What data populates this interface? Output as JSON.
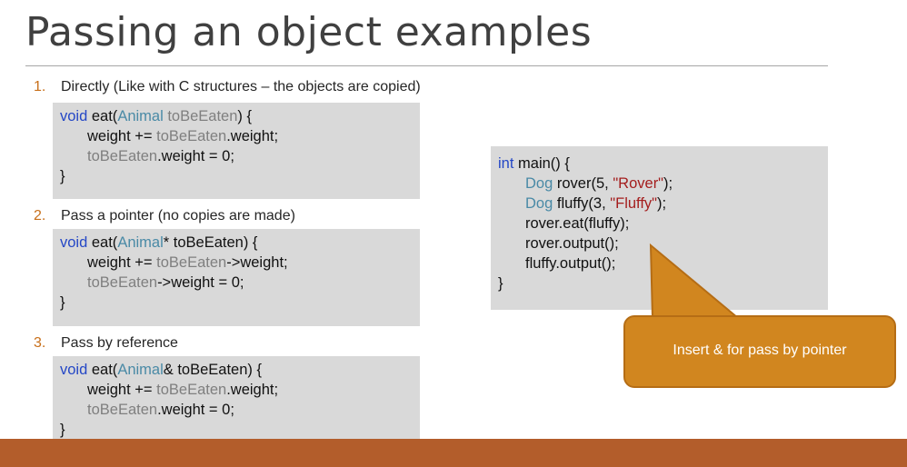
{
  "slide": {
    "title": "Passing an object examples"
  },
  "items": [
    {
      "num": "1.",
      "label": "Directly (Like with C structures – the objects are copied)",
      "code": [
        [
          {
            "t": "void",
            "c": "kw"
          },
          {
            "t": " eat(",
            "c": ""
          },
          {
            "t": "Animal",
            "c": "ty"
          },
          {
            "t": " ",
            "c": ""
          },
          {
            "t": "toBeEaten",
            "c": "id"
          },
          {
            "t": ") {",
            "c": ""
          }
        ],
        [
          {
            "t": "weight += ",
            "c": "",
            "i": 1
          },
          {
            "t": "toBeEaten",
            "c": "id"
          },
          {
            "t": ".weight;",
            "c": ""
          }
        ],
        [
          {
            "t": "toBeEaten",
            "c": "id",
            "i": 1
          },
          {
            "t": ".weight = 0;",
            "c": ""
          }
        ],
        [
          {
            "t": "}",
            "c": ""
          }
        ]
      ]
    },
    {
      "num": "2.",
      "label": "Pass a pointer (no copies are made)",
      "code": [
        [
          {
            "t": "void",
            "c": "kw"
          },
          {
            "t": " eat(",
            "c": ""
          },
          {
            "t": "Animal",
            "c": "ty"
          },
          {
            "t": "* toBeEaten) {",
            "c": ""
          }
        ],
        [
          {
            "t": "weight += ",
            "c": "",
            "i": 1
          },
          {
            "t": "toBeEaten",
            "c": "id"
          },
          {
            "t": "->weight;",
            "c": ""
          }
        ],
        [
          {
            "t": "toBeEaten",
            "c": "id",
            "i": 1
          },
          {
            "t": "->weight = 0;",
            "c": ""
          }
        ],
        [
          {
            "t": "}",
            "c": ""
          }
        ]
      ]
    },
    {
      "num": "3.",
      "label": "Pass by reference",
      "code": [
        [
          {
            "t": "void",
            "c": "kw"
          },
          {
            "t": " eat(",
            "c": ""
          },
          {
            "t": "Animal",
            "c": "ty"
          },
          {
            "t": "& toBeEaten) {",
            "c": ""
          }
        ],
        [
          {
            "t": "weight += ",
            "c": "",
            "i": 1
          },
          {
            "t": "toBeEaten",
            "c": "id"
          },
          {
            "t": ".weight;",
            "c": ""
          }
        ],
        [
          {
            "t": "toBeEaten",
            "c": "id",
            "i": 1
          },
          {
            "t": ".weight = 0;",
            "c": ""
          }
        ],
        [
          {
            "t": "}",
            "c": ""
          }
        ]
      ]
    }
  ],
  "main_code": [
    [
      {
        "t": "int",
        "c": "kw"
      },
      {
        "t": " main() {",
        "c": ""
      }
    ],
    [
      {
        "t": "Dog",
        "c": "ty",
        "i": 1
      },
      {
        "t": " rover(5, ",
        "c": ""
      },
      {
        "t": "\"Rover\"",
        "c": "str"
      },
      {
        "t": ");",
        "c": ""
      }
    ],
    [
      {
        "t": "Dog",
        "c": "ty",
        "i": 1
      },
      {
        "t": " fluffy(3, ",
        "c": ""
      },
      {
        "t": "\"Fluffy\"",
        "c": "str"
      },
      {
        "t": ");",
        "c": ""
      }
    ],
    [
      {
        "t": "rover.eat(fluffy);",
        "c": "",
        "i": 1
      }
    ],
    [
      {
        "t": "rover.output();",
        "c": "",
        "i": 1
      }
    ],
    [
      {
        "t": "fluffy.output();",
        "c": "",
        "i": 1
      }
    ],
    [
      {
        "t": "}",
        "c": ""
      }
    ]
  ],
  "callout": {
    "text": "Insert & for pass by pointer"
  },
  "colors": {
    "keyword": "#2447c6",
    "type": "#4a8aa6",
    "identifier": "#7f7f7f",
    "string": "#a41d1d",
    "list_number": "#c86f1a",
    "callout_fill": "#d1861f",
    "footer_bar": "#b35d2b",
    "code_background": "#d9d9d9"
  }
}
